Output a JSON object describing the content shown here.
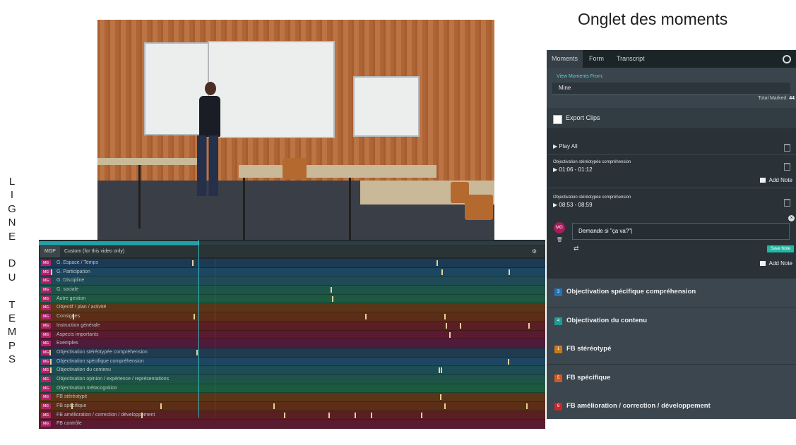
{
  "page": {
    "heading": "Onglet des moments",
    "vertical_label": [
      "L",
      "I",
      "G",
      "N",
      "E",
      "",
      "D",
      "U",
      "",
      "T",
      "E",
      "M",
      "P",
      "S"
    ]
  },
  "timeline": {
    "tabs": [
      "MGP",
      "Custom (for this video only)"
    ],
    "rows": [
      {
        "badge": "MG",
        "label": "G. Espace / Temps",
        "color": "#1d3a55",
        "marks": [
          217,
          563
        ]
      },
      {
        "badge": "MG",
        "label": "G. Participation",
        "color": "#1d4660",
        "marks": [
          17,
          570,
          665
        ]
      },
      {
        "badge": "MG",
        "label": "G. Discipline",
        "color": "#1f4a56",
        "marks": []
      },
      {
        "badge": "MG",
        "label": "G. sociale",
        "color": "#1d5447",
        "marks": [
          413
        ]
      },
      {
        "badge": "MG",
        "label": "Autre gestion",
        "color": "#1c5940",
        "marks": [
          415
        ]
      },
      {
        "badge": "MG",
        "label": "Objectif / plan / activité",
        "color": "#5a3517",
        "marks": []
      },
      {
        "badge": "MG",
        "label": "Consignes",
        "color": "#5d2e17",
        "marks": [
          48,
          219,
          462,
          574
        ]
      },
      {
        "badge": "MG",
        "label": "Instruction générale",
        "color": "#5a1f23",
        "marks": [
          576,
          596,
          693
        ]
      },
      {
        "badge": "MG",
        "label": "Aspects importants",
        "color": "#5a1a2f",
        "marks": [
          581
        ]
      },
      {
        "badge": "MG",
        "label": "Exemples",
        "color": "#4e1b3a",
        "marks": []
      },
      {
        "badge": "MG",
        "label": "Objectivation stéréotypée compréhension",
        "color": "#203a50",
        "marks": [
          15,
          223
        ]
      },
      {
        "badge": "MG",
        "label": "Objectivation spécifique compréhension",
        "color": "#1f4660",
        "marks": [
          16,
          664
        ]
      },
      {
        "badge": "MG",
        "label": "Objectivation du contenu",
        "color": "#1c4d52",
        "marks": [
          16,
          566,
          569
        ]
      },
      {
        "badge": "MG",
        "label": "Objectivation opinion / expérience / représentations",
        "color": "#1e5447",
        "marks": []
      },
      {
        "badge": "MG",
        "label": "Objectivation métacognition",
        "color": "#1c5a3f",
        "marks": []
      },
      {
        "badge": "MG",
        "label": "FB stéréotypé",
        "color": "#5a3517",
        "marks": [
          568
        ]
      },
      {
        "badge": "MG",
        "label": "FB spécifique",
        "color": "#5d2e17",
        "marks": [
          46,
          172,
          332,
          574,
          690
        ]
      },
      {
        "badge": "MG",
        "label": "FB amélioration / correction / développement",
        "color": "#5a1f23",
        "marks": [
          145,
          347,
          410,
          447,
          470,
          541
        ]
      },
      {
        "badge": "MG",
        "label": "FB contrôle",
        "color": "#5a1a2f",
        "marks": []
      }
    ]
  },
  "moments_panel": {
    "tabs": [
      "Moments",
      "Form",
      "Transcript"
    ],
    "view_from_label": "View Moments From:",
    "view_from_value": "Mine",
    "total_marked_label": "Total Marked:",
    "total_marked_value": "44",
    "export_clips": "Export Clips",
    "play_all": "▶ Play All",
    "items": [
      {
        "title": "Objectivation stéréotypée compréhension",
        "time": "▶ 01:06 - 01:12"
      },
      {
        "title": "Objectivation stéréotypée compréhension",
        "time": "▶ 08:53 - 08:59"
      }
    ],
    "add_note": "Add Note",
    "note_avatar": "MG",
    "note_text": "Demande si \"ça va?\"|",
    "save_note": "Save Note",
    "categories": [
      {
        "num": "3",
        "label": "Objectivation spécifique compréhension",
        "color": "#2371b7"
      },
      {
        "num": "4",
        "label": "Objectivation du contenu",
        "color": "#1c9c94"
      },
      {
        "num": "1",
        "label": "FB stéréotypé",
        "color": "#c9781c"
      },
      {
        "num": "5",
        "label": "FB spécifique",
        "color": "#d05a1d"
      },
      {
        "num": "6",
        "label": "FB amélioration / correction / développement",
        "color": "#c8282c"
      }
    ]
  }
}
